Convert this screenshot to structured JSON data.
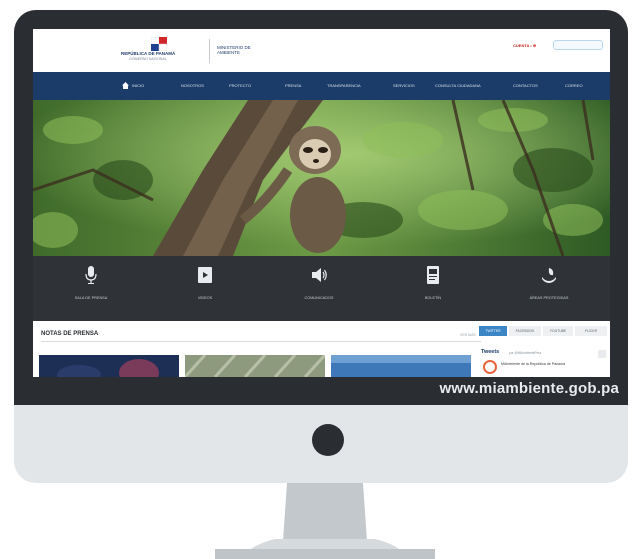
{
  "website": {
    "logo_text": "REPÚBLICA DE PANAMÁ",
    "logo_sub": "GOBIERNO NACIONAL",
    "ministry_name_line1": "MINISTERIO DE",
    "ministry_name_line2": "AMBIENTE",
    "login_link": "CUENTA • ⊕",
    "nav": {
      "items": [
        {
          "label": "INICIO"
        },
        {
          "label": "NOSOTROS"
        },
        {
          "label": "PROTECTO"
        },
        {
          "label": "PRENSA"
        },
        {
          "label": "TRANSPARENCIA"
        },
        {
          "label": "SERVICIOS"
        },
        {
          "label": "CONSULTA CIUDADANA"
        },
        {
          "label": "CONTACTOS"
        },
        {
          "label": "CORREO"
        }
      ]
    },
    "features": [
      {
        "label": "SALA DE PRENSA",
        "icon": "microphone-icon"
      },
      {
        "label": "VIDEOS",
        "icon": "video-icon"
      },
      {
        "label": "COMUNICADOS",
        "icon": "speaker-icon"
      },
      {
        "label": "BOLETÍN",
        "icon": "document-icon"
      },
      {
        "label": "ÁREAS PROTEGIDAS",
        "icon": "leaf-hand-icon"
      }
    ],
    "news": {
      "title": "NOTAS DE PRENSA",
      "more_link": "VER MÁS"
    },
    "sidebar_tabs": [
      "TWITTER",
      "FACEBOOK",
      "YOUTUBE",
      "FLICKR"
    ],
    "social": {
      "title": "Tweets",
      "sub": "por @MiAmbientePma",
      "text": "MiAmbiente de la República de Panamá"
    }
  },
  "url_label": "www.miambiente.gob.pa",
  "colors": {
    "bezel": "#2a2d32",
    "chin": "#e3e6e8",
    "nav": "#1b3b68",
    "feature_bar": "#2f3337",
    "accent": "#c8281e"
  }
}
